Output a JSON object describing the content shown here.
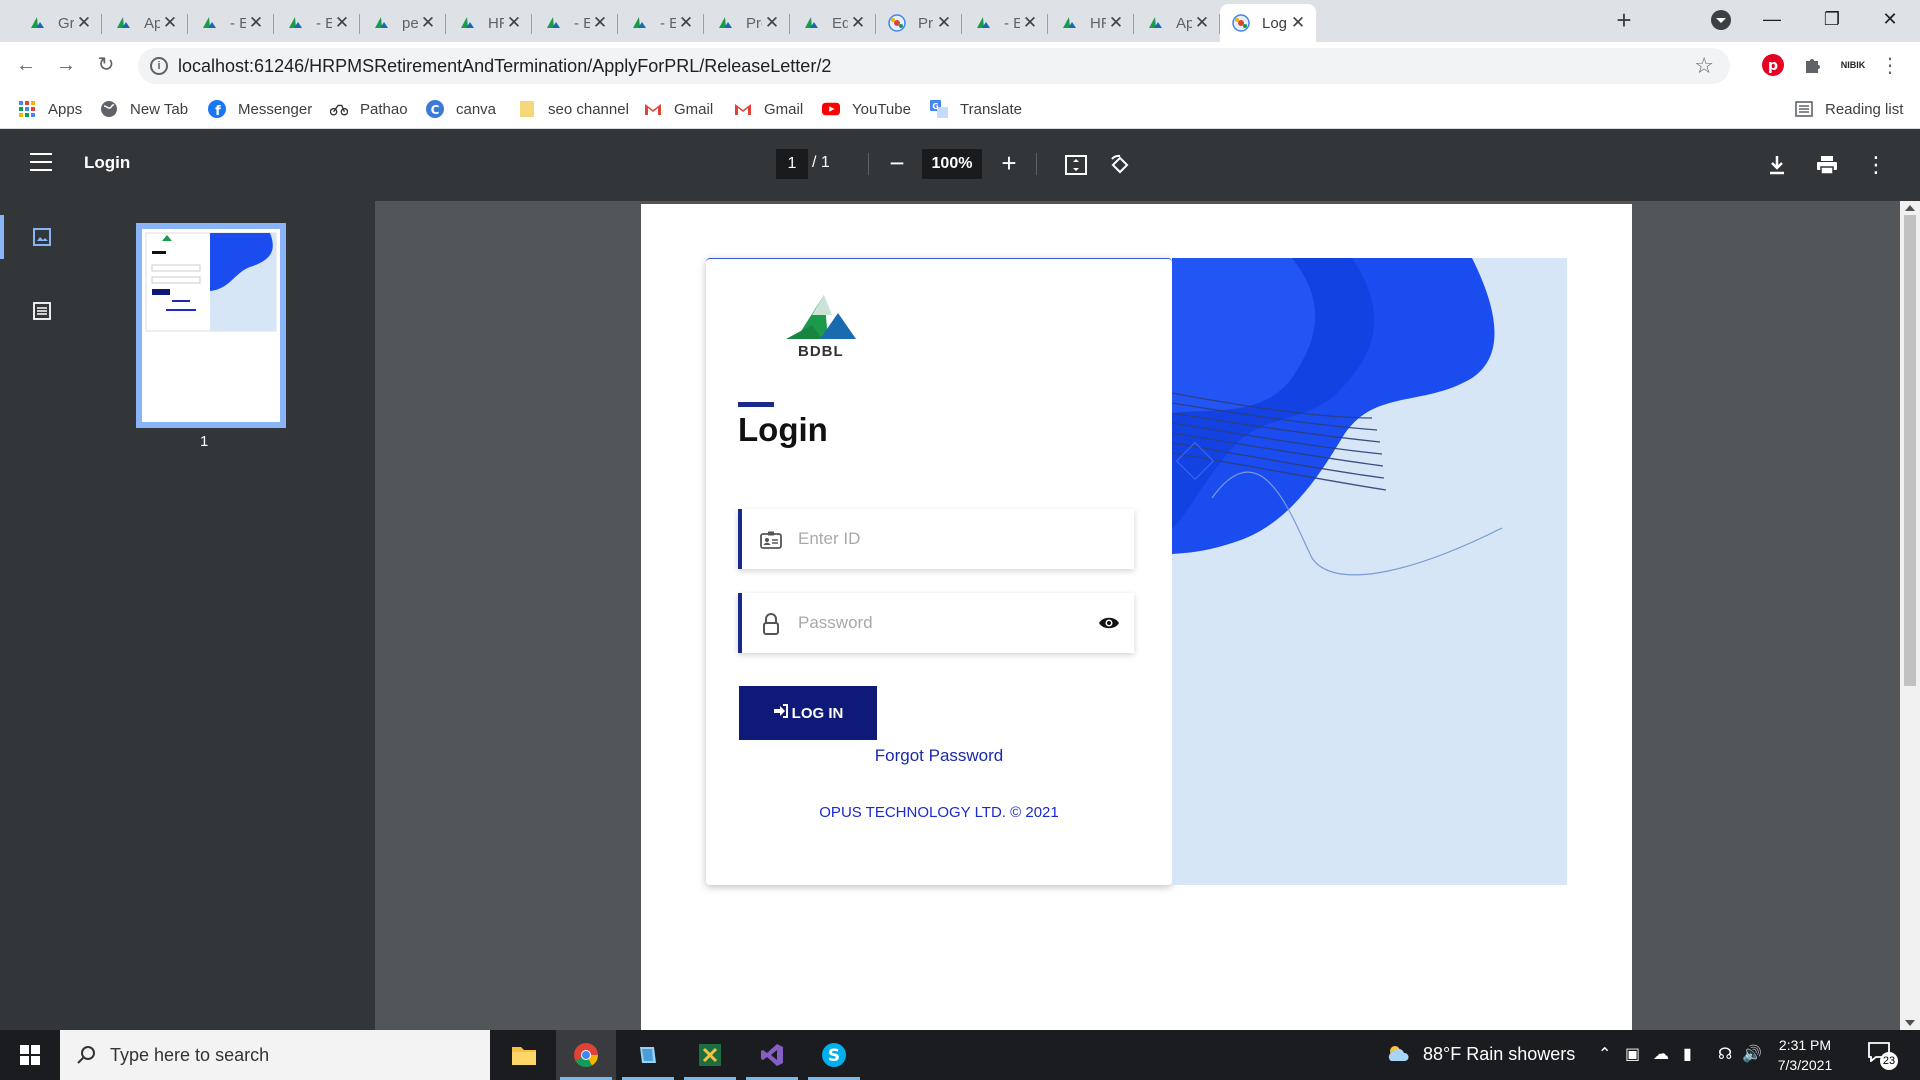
{
  "browser": {
    "tabs": [
      {
        "title": "Gric",
        "icon": "bdbl-icon",
        "active": false
      },
      {
        "title": "App",
        "icon": "bdbl-icon",
        "active": false
      },
      {
        "title": "- ER",
        "icon": "bdbl-icon",
        "active": false
      },
      {
        "title": "- ER",
        "icon": "bdbl-icon",
        "active": false
      },
      {
        "title": "pen",
        "icon": "bdbl-icon",
        "active": false
      },
      {
        "title": "HRI",
        "icon": "bdbl-icon",
        "active": false
      },
      {
        "title": "- ER",
        "icon": "bdbl-icon",
        "active": false
      },
      {
        "title": "- ER",
        "icon": "bdbl-icon",
        "active": false
      },
      {
        "title": "Prof",
        "icon": "bdbl-icon",
        "active": false
      },
      {
        "title": "Edit",
        "icon": "bdbl-icon",
        "active": false
      },
      {
        "title": "Prin",
        "icon": "globe-icon",
        "active": false
      },
      {
        "title": "- ER",
        "icon": "bdbl-icon",
        "active": false
      },
      {
        "title": "HRI",
        "icon": "bdbl-icon",
        "active": false
      },
      {
        "title": "App",
        "icon": "bdbl-icon",
        "active": false
      },
      {
        "title": "Log",
        "icon": "globe-icon",
        "active": true
      }
    ],
    "url": "localhost:61246/HRPMSRetirementAndTermination/ApplyForPRL/ReleaseLetter/2",
    "bookmarks": [
      {
        "label": "Apps",
        "icon": "apps-grid-icon"
      },
      {
        "label": "New Tab",
        "icon": "globe-icon"
      },
      {
        "label": "Messenger",
        "icon": "facebook-icon"
      },
      {
        "label": "Pathao",
        "icon": "bike-icon"
      },
      {
        "label": "canva",
        "icon": "canva-icon"
      },
      {
        "label": "seo channel",
        "icon": "folder-icon"
      },
      {
        "label": "Gmail",
        "icon": "gmail-icon"
      },
      {
        "label": "Gmail",
        "icon": "gmail-icon"
      },
      {
        "label": "YouTube",
        "icon": "youtube-icon"
      },
      {
        "label": "Translate",
        "icon": "translate-icon"
      }
    ],
    "reading_list": "Reading list",
    "extension_label": "NIBIK"
  },
  "pdf_viewer": {
    "title": "Login",
    "page_current": "1",
    "page_total": "/  1",
    "zoom": "100%",
    "thumbnail_label": "1"
  },
  "login_page": {
    "logo_text": "BDBL",
    "heading": "Login",
    "id_placeholder": "Enter ID",
    "password_placeholder": "Password",
    "login_button": "LOG IN",
    "forgot_password": "Forgot Password",
    "footer": "OPUS TECHNOLOGY LTD. © 2021"
  },
  "taskbar": {
    "search_placeholder": "Type here to search",
    "weather": "88°F  Rain showers",
    "time": "2:31 PM",
    "date": "7/3/2021",
    "notification_count": "23"
  },
  "colors": {
    "brand_navy": "#0f1a78",
    "art_blue": "#1a4cf0",
    "art_background": "#d6e6f6",
    "logo_green": "#1a9a4a",
    "logo_blue": "#1a6ab0"
  }
}
